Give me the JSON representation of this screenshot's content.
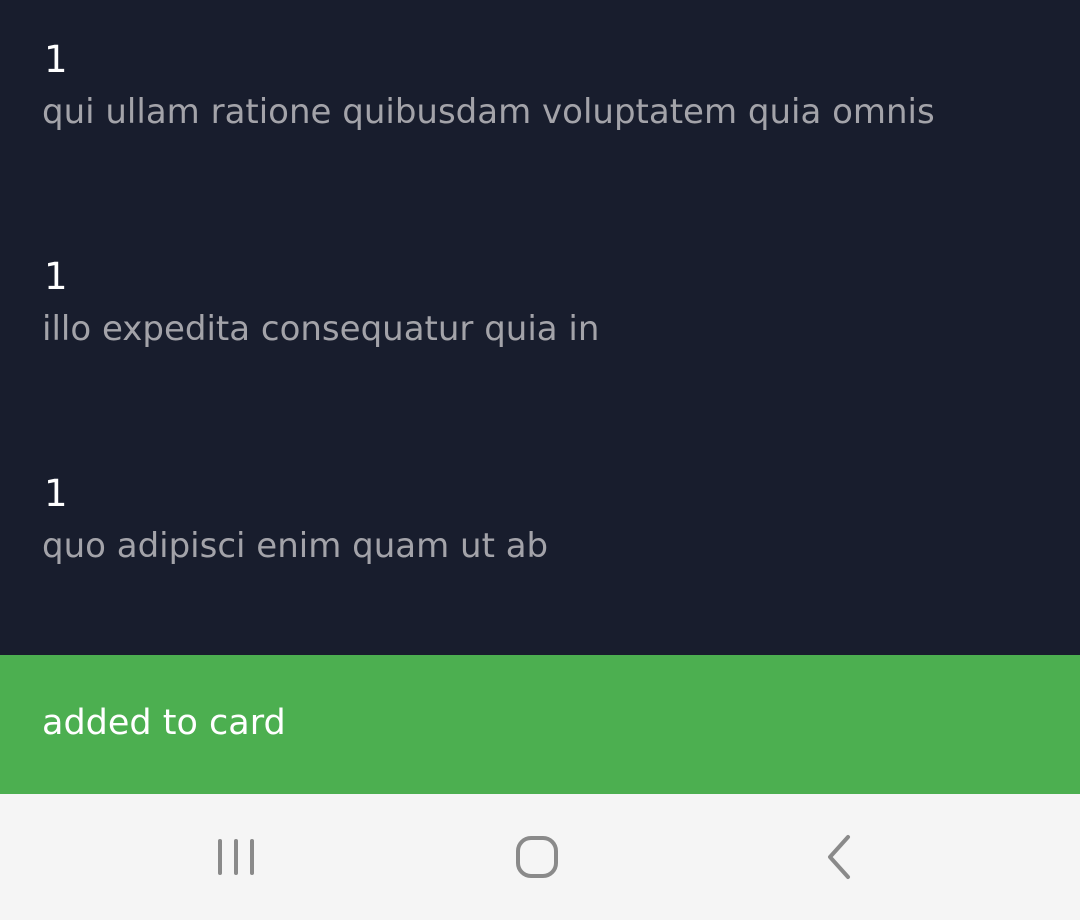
{
  "items": [
    {
      "id": "1",
      "title": "qui ullam ratione quibusdam voluptatem quia omnis"
    },
    {
      "id": "1",
      "title": "illo expedita consequatur quia in"
    },
    {
      "id": "1",
      "title": "quo adipisci enim quam ut ab"
    }
  ],
  "snackbar": {
    "message": "added to card",
    "color": "#4caf50"
  },
  "navbar": {
    "buttons": [
      "recent-apps-icon",
      "home-icon",
      "back-icon"
    ]
  },
  "colors": {
    "background": "#181d2d",
    "id_text": "#ffffff",
    "title_text": "#a3a3a9",
    "navbar_bg": "#f5f5f5",
    "navbar_icon": "#8a8a8a"
  }
}
